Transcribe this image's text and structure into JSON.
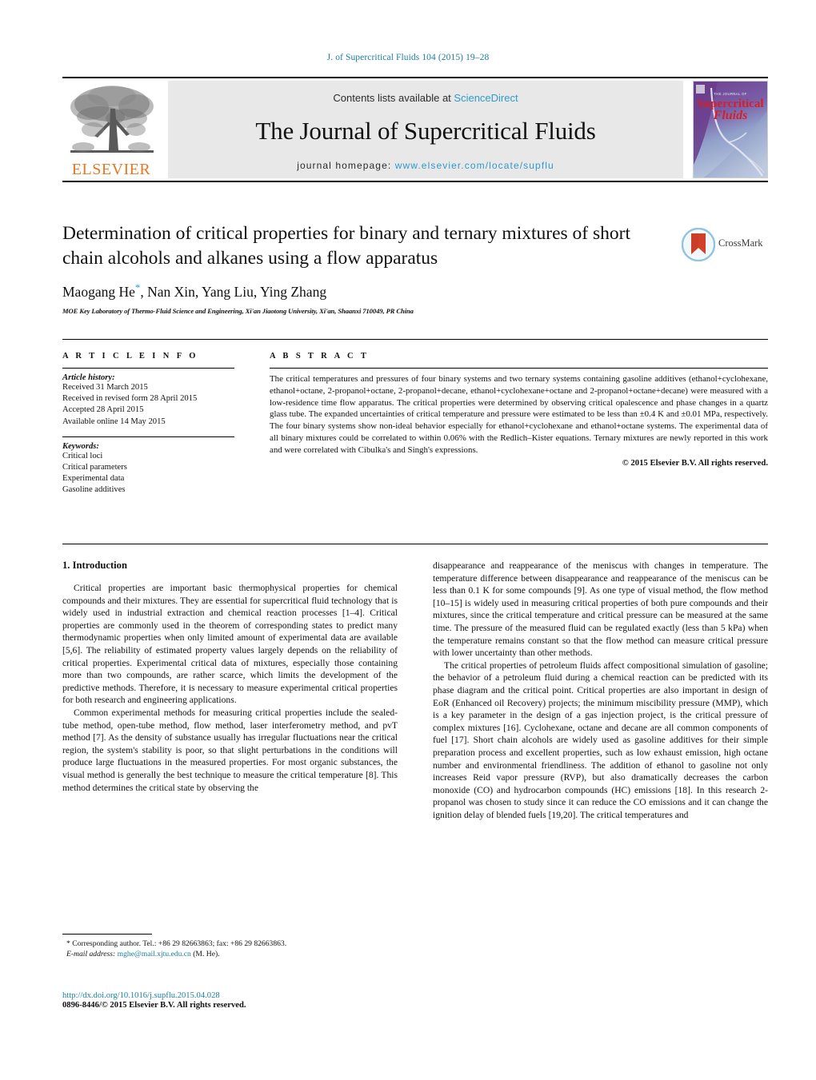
{
  "running_head": "J. of Supercritical Fluids 104 (2015) 19–28",
  "masthead": {
    "publisher_name": "ELSEVIER",
    "contents_prefix": "Contents lists available at ",
    "contents_link": "ScienceDirect",
    "journal_title": "The Journal of Supercritical Fluids",
    "homepage_prefix": "journal homepage: ",
    "homepage_url": "www.elsevier.com/locate/supflu",
    "cover_line1": "THE JOURNAL OF",
    "cover_line2": "Supercritical",
    "cover_line3": "Fluids"
  },
  "article": {
    "title": "Determination of critical properties for binary and ternary mixtures of short chain alcohols and alkanes using a flow apparatus",
    "authors": "Maogang He, Nan Xin, Yang Liu, Ying Zhang",
    "authors_prefix": "Maogang He",
    "authors_suffix": ", Nan Xin, Yang Liu, Ying Zhang",
    "corresponding_marker": "*",
    "affiliation": "MOE Key Laboratory of Thermo-Fluid Science and Engineering, Xi'an Jiaotong University, Xi'an, Shaanxi 710049, PR China",
    "crossmark_label": "CrossMark"
  },
  "article_info": {
    "heading": "A R T I C L E   I N F O",
    "history_label": "Article history:",
    "history": [
      "Received 31 March 2015",
      "Received in revised form 28 April 2015",
      "Accepted 28 April 2015",
      "Available online 14 May 2015"
    ],
    "keywords_label": "Keywords:",
    "keywords": [
      "Critical loci",
      "Critical parameters",
      "Experimental data",
      "Gasoline additives"
    ]
  },
  "abstract": {
    "heading": "A B S T R A C T",
    "text": "The critical temperatures and pressures of four binary systems and two ternary systems containing gasoline additives (ethanol+cyclohexane, ethanol+octane, 2-propanol+octane, 2-propanol+decane, ethanol+cyclohexane+octane and 2-propanol+octane+decane) were measured with a low-residence time flow apparatus. The critical properties were determined by observing critical opalescence and phase changes in a quartz glass tube. The expanded uncertainties of critical temperature and pressure were estimated to be less than ±0.4 K and ±0.01 MPa, respectively. The four binary systems show non-ideal behavior especially for ethanol+cyclohexane and ethanol+octane systems. The experimental data of all binary mixtures could be correlated to within 0.06% with the Redlich–Kister equations. Ternary mixtures are newly reported in this work and were correlated with Cibulka's and Singh's expressions.",
    "copyright": "© 2015 Elsevier B.V. All rights reserved."
  },
  "body": {
    "section_number_title": "1.  Introduction",
    "left_paragraphs": [
      "Critical properties are important basic thermophysical properties for chemical compounds and their mixtures. They are essential for supercritical fluid technology that is widely used in industrial extraction and chemical reaction processes [1–4]. Critical properties are commonly used in the theorem of corresponding states to predict many thermodynamic properties when only limited amount of experimental data are available [5,6]. The reliability of estimated property values largely depends on the reliability of critical properties. Experimental critical data of mixtures, especially those containing more than two compounds, are rather scarce, which limits the development of the predictive methods. Therefore, it is necessary to measure experimental critical properties for both research and engineering applications.",
      "Common experimental methods for measuring critical properties include the sealed-tube method, open-tube method, flow method, laser interferometry method, and pvT method [7]. As the density of substance usually has irregular fluctuations near the critical region, the system's stability is poor, so that slight perturbations in the conditions will produce large fluctuations in the measured properties. For most organic substances, the visual method is generally the best technique to measure the critical temperature [8]. This method determines the critical state by observing the"
    ],
    "right_paragraphs": [
      "disappearance and reappearance of the meniscus with changes in temperature. The temperature difference between disappearance and reappearance of the meniscus can be less than 0.1 K for some compounds [9]. As one type of visual method, the flow method [10–15] is widely used in measuring critical properties of both pure compounds and their mixtures, since the critical temperature and critical pressure can be measured at the same time. The pressure of the measured fluid can be regulated exactly (less than 5 kPa) when the temperature remains constant so that the flow method can measure critical pressure with lower uncertainty than other methods.",
      "The critical properties of petroleum fluids affect compositional simulation of gasoline; the behavior of a petroleum fluid during a chemical reaction can be predicted with its phase diagram and the critical point. Critical properties are also important in design of EoR (Enhanced oil Recovery) projects; the minimum miscibility pressure (MMP), which is a key parameter in the design of a gas injection project, is the critical pressure of complex mixtures [16]. Cyclohexane, octane and decane are all common components of fuel [17]. Short chain alcohols are widely used as gasoline additives for their simple preparation process and excellent properties, such as low exhaust emission, high octane number and environmental friendliness. The addition of ethanol to gasoline not only increases Reid vapor pressure (RVP), but also dramatically decreases the carbon monoxide (CO) and hydrocarbon compounds (HC) emissions [18]. In this research 2-propanol was chosen to study since it can reduce the CO emissions and it can change the ignition delay of blended fuels [19,20]. The critical temperatures and"
    ]
  },
  "footnote": {
    "line1": "* Corresponding author. Tel.: +86 29 82663863; fax: +86 29 82663863.",
    "email_label": "E-mail address:",
    "email": "mghe@mail.xjtu.edu.cn",
    "email_suffix": " (M. He).",
    "doi": "http://dx.doi.org/10.1016/j.supflu.2015.04.028",
    "issn": "0896-8446/© 2015 Elsevier B.V. All rights reserved."
  },
  "colors": {
    "link": "#2e9bc9",
    "ref": "#1b7fa0",
    "elsevier_orange": "#e87722",
    "band_gray": "#e8e8e8"
  }
}
